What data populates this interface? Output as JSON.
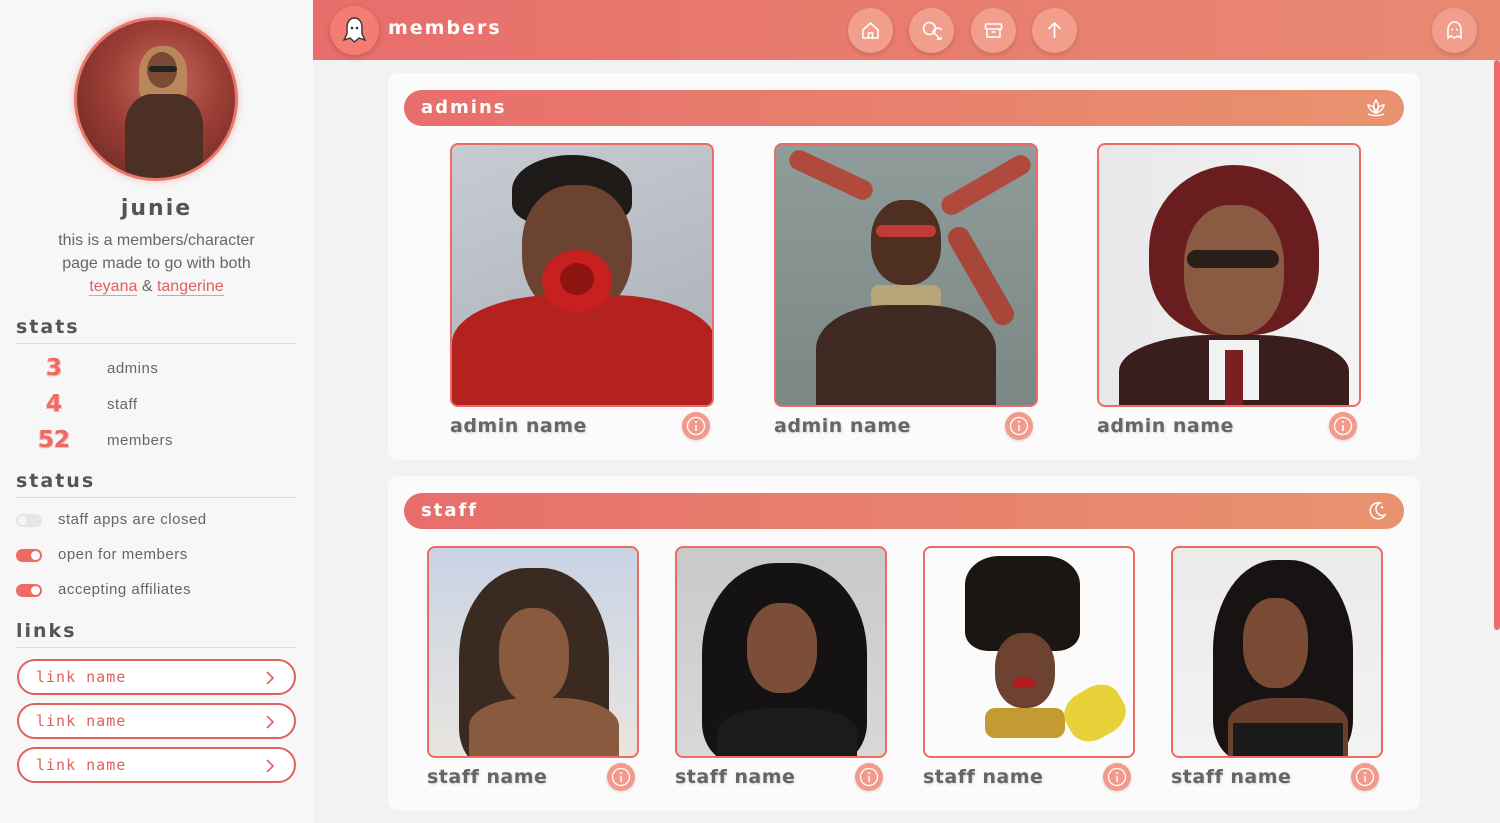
{
  "profile": {
    "name": "junie",
    "bio_line1": "this is a members/character",
    "bio_line2": "page made to go with both",
    "bio_link1": "teyana",
    "bio_amp": "&",
    "bio_link2": "tangerine"
  },
  "stats": {
    "heading": "stats",
    "items": [
      {
        "value": "3",
        "label": "admins"
      },
      {
        "value": "4",
        "label": "staff"
      },
      {
        "value": "52",
        "label": "members"
      }
    ]
  },
  "status": {
    "heading": "status",
    "items": [
      {
        "label": "staff apps are closed",
        "on": false
      },
      {
        "label": "open for members",
        "on": true
      },
      {
        "label": "accepting affiliates",
        "on": true
      }
    ]
  },
  "links": {
    "heading": "links",
    "items": [
      {
        "label": "link name"
      },
      {
        "label": "link name"
      },
      {
        "label": "link name"
      }
    ]
  },
  "topbar": {
    "title": "members",
    "nav_icons": [
      "home-icon",
      "chat-icon",
      "archive-icon",
      "arrow-up-icon"
    ],
    "right_icon": "ghost-icon"
  },
  "admins": {
    "title": "admins",
    "header_icon": "lotus-icon",
    "cards": [
      {
        "name": "admin name"
      },
      {
        "name": "admin name"
      },
      {
        "name": "admin name"
      }
    ]
  },
  "staff": {
    "title": "staff",
    "header_icon": "moon-icon",
    "cards": [
      {
        "name": "staff name"
      },
      {
        "name": "staff name"
      },
      {
        "name": "staff name"
      },
      {
        "name": "staff name"
      }
    ]
  },
  "colors": {
    "accent": "#ee6b63",
    "gradient_start": "#e86e6c",
    "gradient_end": "#e8936f"
  }
}
